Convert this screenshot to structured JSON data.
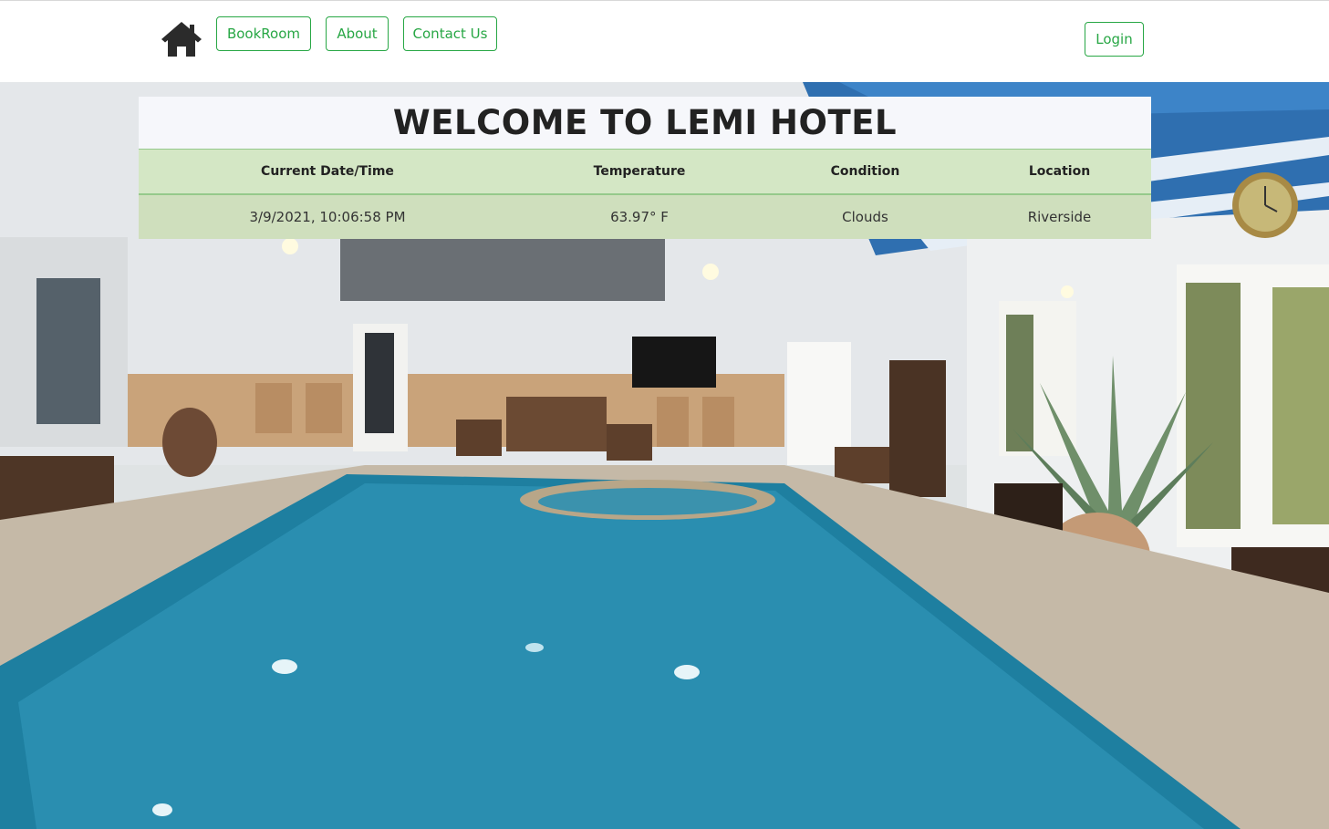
{
  "nav": {
    "home_icon": "home-icon",
    "book_label": "BookRoom",
    "about_label": "About",
    "contact_label": "Contact Us",
    "login_label": "Login",
    "accent_color": "#28a745"
  },
  "hero": {
    "title": "WELCOME TO LEMI HOTEL",
    "image": "indoor-pool-photo"
  },
  "weather_table": {
    "headers": [
      "Current Date/Time",
      "Temperature",
      "Condition",
      "Location"
    ],
    "row": [
      "3/9/2021, 10:06:58 PM",
      "63.97° F",
      "Clouds",
      "Riverside"
    ],
    "header_bg": "#d4e7c5",
    "row_bg": "#cfdfbd"
  }
}
